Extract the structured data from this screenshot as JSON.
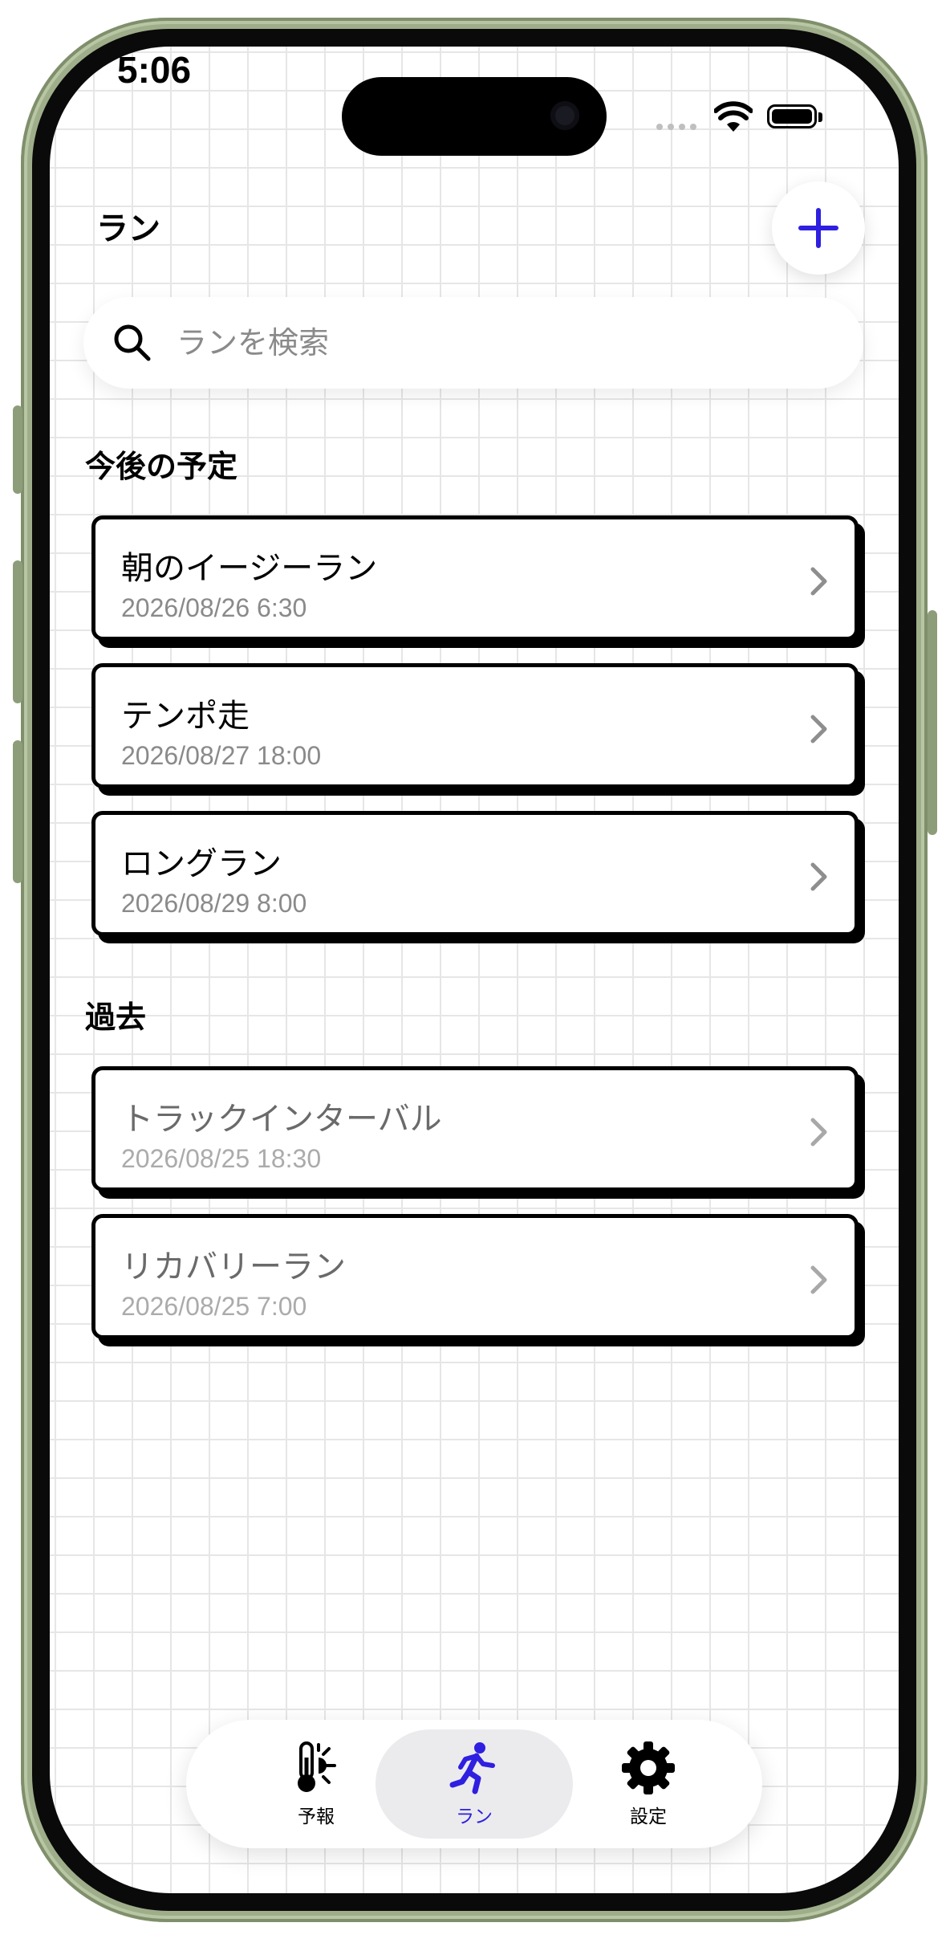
{
  "status_bar": {
    "time": "5:06"
  },
  "header": {
    "title": "ラン"
  },
  "search": {
    "placeholder": "ランを検索"
  },
  "sections": {
    "upcoming": {
      "title": "今後の予定",
      "items": [
        {
          "title": "朝のイージーラン",
          "datetime": "2026/08/26 6:30"
        },
        {
          "title": "テンポ走",
          "datetime": "2026/08/27 18:00"
        },
        {
          "title": "ロングラン",
          "datetime": "2026/08/29 8:00"
        }
      ]
    },
    "past": {
      "title": "過去",
      "items": [
        {
          "title": "トラックインターバル",
          "datetime": "2026/08/25 18:30"
        },
        {
          "title": "リカバリーラン",
          "datetime": "2026/08/25 7:00"
        }
      ]
    }
  },
  "tabbar": {
    "tabs": [
      {
        "label": "予報",
        "icon": "thermometer-sun-icon"
      },
      {
        "label": "ラン",
        "icon": "running-person-icon",
        "active": true
      },
      {
        "label": "設定",
        "icon": "gear-icon"
      }
    ]
  },
  "colors": {
    "accent": "#2f1fe0",
    "card_border": "#000000",
    "grid_line": "#e6e6e6",
    "secondary_text": "#8a8a8a",
    "frame": "#9fae8a"
  }
}
